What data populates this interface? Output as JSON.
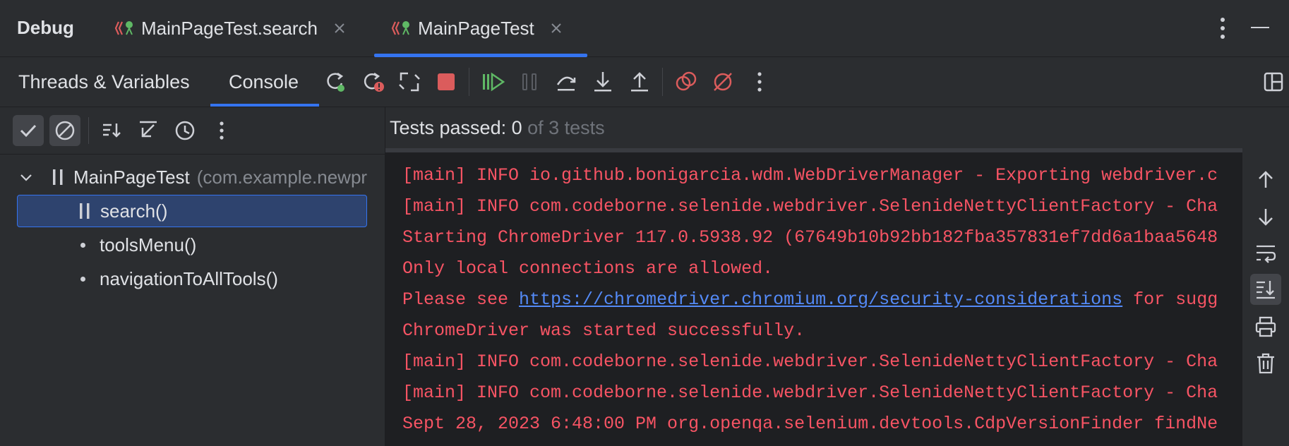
{
  "header": {
    "title": "Debug",
    "tabs": [
      {
        "label": "MainPageTest.search",
        "active": false
      },
      {
        "label": "MainPageTest",
        "active": true
      }
    ]
  },
  "toolbar": {
    "tabs": [
      {
        "label": "Threads & Variables",
        "active": false
      },
      {
        "label": "Console",
        "active": true
      }
    ],
    "icons": [
      "rerun-icon",
      "rerun-failed-icon",
      "restart-icon",
      "stop-icon",
      "resume-icon",
      "pause-icon",
      "step-over-icon",
      "step-into-icon",
      "step-out-icon",
      "view-breakpoints-icon",
      "mute-breakpoints-icon",
      "more-icon",
      "layout-icon"
    ]
  },
  "tests": {
    "tools": [
      "show-passed-icon",
      "show-ignored-icon",
      "sort-icon",
      "collapse-icon",
      "history-icon",
      "more-icon"
    ],
    "tree": [
      {
        "label": "MainPageTest",
        "sublabel": "(com.example.newpr",
        "status": "paused",
        "expanded": true
      },
      {
        "label": "search()",
        "status": "paused",
        "selected": true
      },
      {
        "label": "toolsMenu()",
        "status": "pending"
      },
      {
        "label": "navigationToAllTools()",
        "status": "pending"
      }
    ]
  },
  "status": {
    "passed_label": "Tests passed: 0",
    "of_label": "of 3 tests"
  },
  "console": {
    "lines": [
      "[main] INFO io.github.bonigarcia.wdm.WebDriverManager - Exporting webdriver.c",
      "[main] INFO com.codeborne.selenide.webdriver.SelenideNettyClientFactory - Cha",
      "Starting ChromeDriver 117.0.5938.92 (67649b10b92bb182fba357831ef7dd6a1baa5648",
      "Only local connections are allowed.",
      "ChromeDriver was started successfully.",
      "[main] INFO com.codeborne.selenide.webdriver.SelenideNettyClientFactory - Cha",
      "[main] INFO com.codeborne.selenide.webdriver.SelenideNettyClientFactory - Cha",
      "Sept 28, 2023 6:48:00 PM org.openqa.selenium.devtools.CdpVersionFinder findNe"
    ],
    "link_line_prefix": "Please see ",
    "link_text": "https://chromedriver.chromium.org/security-considerations",
    "link_line_suffix": " for sugg"
  },
  "colors": {
    "accent": "#3574f0",
    "error_text": "#f75464",
    "link": "#548af7",
    "success": "#5fb865",
    "stop": "#db5c5c"
  }
}
